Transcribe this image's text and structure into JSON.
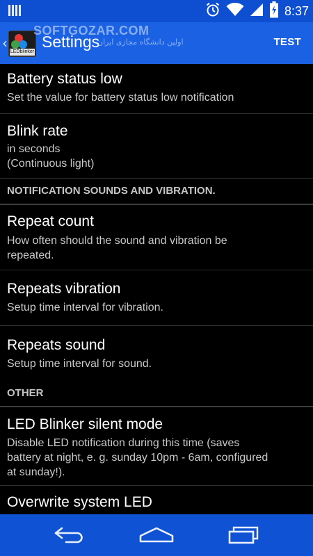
{
  "status_bar": {
    "time": "8:37",
    "icons": [
      "notification-bars-icon",
      "alarm-icon",
      "wifi-icon",
      "signal-icon",
      "battery-icon"
    ]
  },
  "action_bar": {
    "title": "Settings",
    "action_label": "TEST",
    "app_icon_label": "LEDblinker",
    "watermark": "SOFTGOZAR.COM",
    "watermark_sub": "اولین دانشگاه مجازی ایران"
  },
  "preferences": [
    {
      "type": "item",
      "title": "Battery status low",
      "summary": [
        "Set the value for battery status low notification"
      ]
    },
    {
      "type": "item",
      "title": "Blink rate",
      "summary": [
        "in seconds",
        "(Continuous light)"
      ]
    },
    {
      "type": "category",
      "label": "NOTIFICATION SOUNDS AND VIBRATION."
    },
    {
      "type": "item",
      "title": "Repeat count",
      "summary": [
        "How often should the sound and vibration be",
        "repeated."
      ]
    },
    {
      "type": "item",
      "title": "Repeats vibration",
      "summary": [
        "Setup time interval for vibration."
      ]
    },
    {
      "type": "item",
      "title": "Repeats sound",
      "summary": [
        "Setup time interval for sound."
      ]
    },
    {
      "type": "category",
      "label": "OTHER"
    },
    {
      "type": "item",
      "title": "LED Blinker silent mode",
      "summary": [
        "Disable LED notification during this time (saves",
        "battery at night, e. g. sunday 10pm - 6am, configured",
        "at sunday!)."
      ]
    },
    {
      "type": "item",
      "title": "Overwrite system LED",
      "summary": []
    }
  ],
  "nav_bar": {
    "buttons": [
      "back-icon",
      "home-icon",
      "recent-apps-icon"
    ]
  },
  "colors": {
    "status_bar": "#0d4fd0",
    "action_bar": "#1a62e3",
    "nav_bar": "#0f52d4",
    "background": "#000000"
  }
}
